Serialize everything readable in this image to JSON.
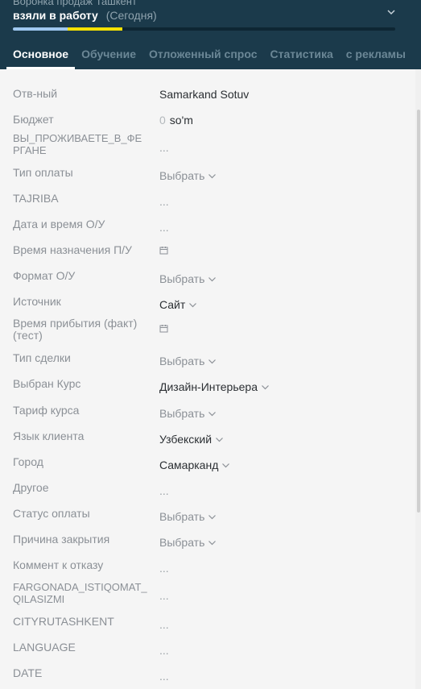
{
  "header": {
    "pipeline_name": "Воронка продаж Ташкент",
    "status_name": "взяли в работу",
    "status_when": "(Сегодня)"
  },
  "tabs": [
    {
      "label": "Основное",
      "active": true
    },
    {
      "label": "Обучение"
    },
    {
      "label": "Отложенный спрос"
    },
    {
      "label": "Статистика"
    },
    {
      "label": "с рекламы"
    }
  ],
  "fields": {
    "responsible": {
      "label": "Отв-ный",
      "value": "Samarkand Sotuv"
    },
    "budget": {
      "label": "Бюджет",
      "amount": "0",
      "currency": "so'm"
    },
    "fergana": {
      "label": "ВЫ_ПРОЖИВАЕТЕ_В_ФЕРГАНЕ",
      "value": "..."
    },
    "payment_type": {
      "label": "Тип оплаты",
      "value": "Выбрать"
    },
    "tajriba": {
      "label": "TAJRIBA",
      "value": "..."
    },
    "ou_datetime": {
      "label": "Дата и время О/У",
      "value": "..."
    },
    "pu_time": {
      "label": "Время назначения П/У"
    },
    "ou_format": {
      "label": "Формат О/У",
      "value": "Выбрать"
    },
    "source": {
      "label": "Источник",
      "value": "Сайт"
    },
    "arrival_time": {
      "label": "Время прибытия (факт) (тест)"
    },
    "deal_type": {
      "label": "Тип сделки",
      "value": "Выбрать"
    },
    "course": {
      "label": "Выбран Курс",
      "value": "Дизайн-Интерьера"
    },
    "tariff": {
      "label": "Тариф курса",
      "value": "Выбрать"
    },
    "language": {
      "label": "Язык клиента",
      "value": "Узбекский"
    },
    "city": {
      "label": "Город",
      "value": "Самарканд"
    },
    "other": {
      "label": "Другое",
      "value": "..."
    },
    "payment_status": {
      "label": "Статус оплаты",
      "value": "Выбрать"
    },
    "close_reason": {
      "label": "Причина закрытия",
      "value": "Выбрать"
    },
    "refusal_comment": {
      "label": "Коммент к отказу",
      "value": "..."
    },
    "fargona": {
      "label": "FARGONADA_ISTIQOMAT_QILASIZMI",
      "value": "..."
    },
    "cityrutashkent": {
      "label": "CITYRUTASHKENT",
      "value": "..."
    },
    "language_field": {
      "label": "LANGUAGE",
      "value": "..."
    },
    "date_field": {
      "label": "DATE",
      "value": "..."
    }
  },
  "icons": {
    "chevron": "chevron-down-icon",
    "calendar": "calendar-icon"
  },
  "colors": {
    "header_bg": "#1b3a4b",
    "progress_done": "#9fc8f0",
    "progress_current": "#f5e100"
  }
}
